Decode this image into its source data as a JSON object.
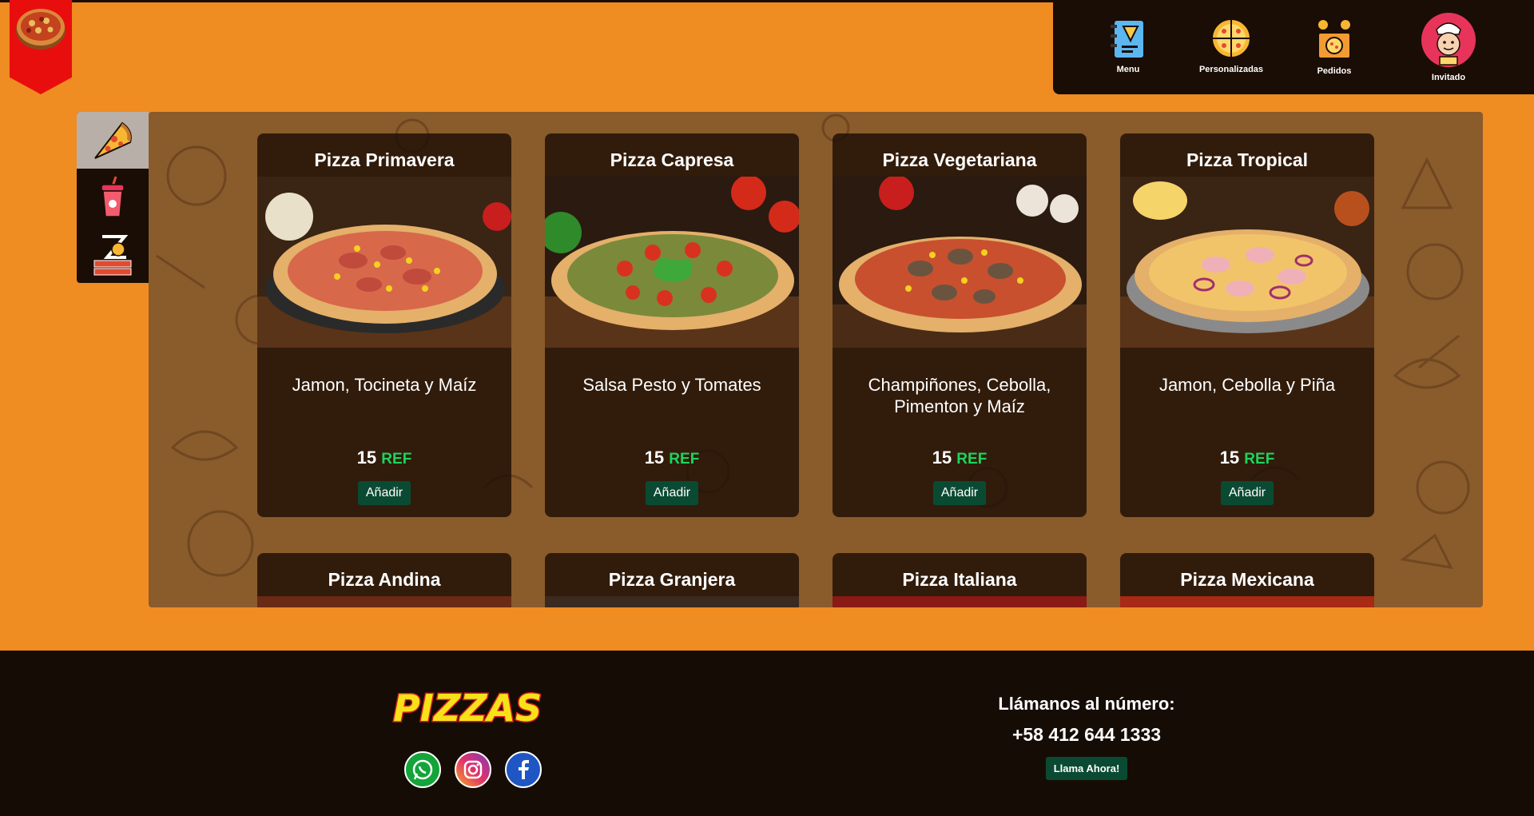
{
  "navbar": {
    "items": [
      {
        "label": "Menu",
        "icon": "menu-book-icon"
      },
      {
        "label": "Personalizadas",
        "icon": "pizza-slices-icon"
      },
      {
        "label": "Pedidos",
        "icon": "delivery-box-icon"
      }
    ],
    "user": {
      "label": "Invitado",
      "icon": "chef-avatar-icon"
    }
  },
  "sidebar": {
    "items": [
      {
        "name": "pizzas",
        "icon": "pizza-slice-icon",
        "active": true
      },
      {
        "name": "bebidas",
        "icon": "soda-cup-icon",
        "active": false
      },
      {
        "name": "combos",
        "icon": "combo-box-icon",
        "active": false
      }
    ]
  },
  "products": [
    {
      "title": "Pizza Primavera",
      "desc": "Jamon, Tocineta y Maíz",
      "price": "15",
      "currency": "REF",
      "button": "Añadir"
    },
    {
      "title": "Pizza Capresa",
      "desc": "Salsa Pesto y Tomates",
      "price": "15",
      "currency": "REF",
      "button": "Añadir"
    },
    {
      "title": "Pizza Vegetariana",
      "desc": "Champiñones, Cebolla, Pimenton y Maíz",
      "price": "15",
      "currency": "REF",
      "button": "Añadir"
    },
    {
      "title": "Pizza Tropical",
      "desc": "Jamon, Cebolla y Piña",
      "price": "15",
      "currency": "REF",
      "button": "Añadir"
    },
    {
      "title": "Pizza Andina"
    },
    {
      "title": "Pizza Granjera"
    },
    {
      "title": "Pizza Italiana"
    },
    {
      "title": "Pizza Mexicana"
    }
  ],
  "footer": {
    "brand": "PIZZAS",
    "social": [
      "whatsapp-icon",
      "instagram-icon",
      "facebook-icon"
    ],
    "call_label": "Llámanos al número:",
    "phone": "+58 412 644 1333",
    "call_button": "Llama Ahora!"
  },
  "colors": {
    "background": "#ef8c22",
    "dark": "#1a0d05",
    "panel": "#8a5b2b",
    "accent_green": "#1ed45b",
    "button_green": "#0b4a32",
    "logo_red": "#e90e0e"
  }
}
